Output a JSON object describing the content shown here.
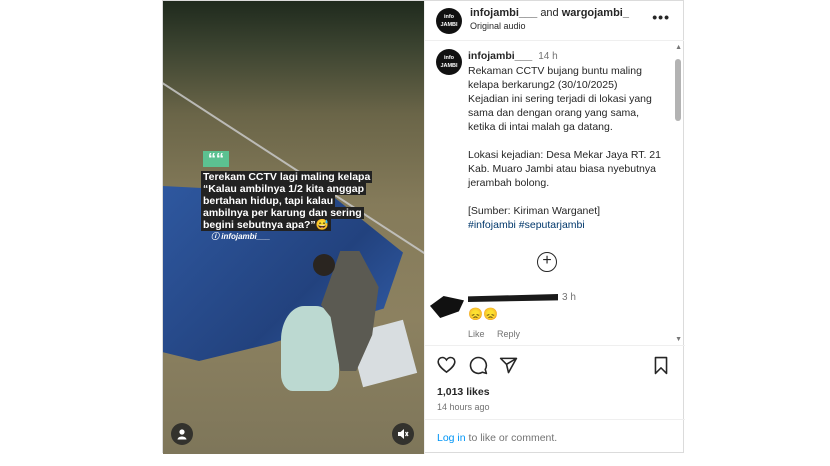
{
  "header": {
    "users": "infojambi___",
    "joiner": "and",
    "second_user": "wargojambi_",
    "audio": "Original audio",
    "more": "•••",
    "avatar_text": "info JAMBI"
  },
  "media": {
    "quote_mark": "““",
    "caption": "Terekam CCTV lagi maling kelapa “Kalau ambilnya 1/2 kita anggap bertahan hidup, tapi kalau ambilnya per karung dan sering begini sebutnya apa?”😅",
    "watermark": "ⓘ infojambi___",
    "user_icon": "user-tag-icon",
    "sound_icon": "mute-icon"
  },
  "post": {
    "username": "infojambi___",
    "time": "14 h",
    "lines": [
      "Rekaman CCTV bujang buntu maling kelapa berkarung2 (30/10/2025)",
      "Kejadian ini sering terjadi di lokasi yang sama dan dengan orang yang sama, ketika di intai malah ga datang."
    ],
    "location": "Lokasi kejadian: Desa Mekar Jaya RT. 21 Kab. Muaro Jambi atau biasa nyebutnya jerambah bolong.",
    "source": "[Sumber: Kiriman Warganet]",
    "hashtags": "#infojambi #seputarjambi"
  },
  "comment": {
    "time": "3 h",
    "emoji": "😞😞",
    "like": "Like",
    "reply": "Reply"
  },
  "stats": {
    "likes": "1,013 likes",
    "ago": "14 hours ago"
  },
  "footer": {
    "login": "Log in",
    "rest": " to like or comment."
  },
  "icons": [
    "heart-icon",
    "comment-icon",
    "share-icon",
    "bookmark-icon",
    "add-icon"
  ]
}
